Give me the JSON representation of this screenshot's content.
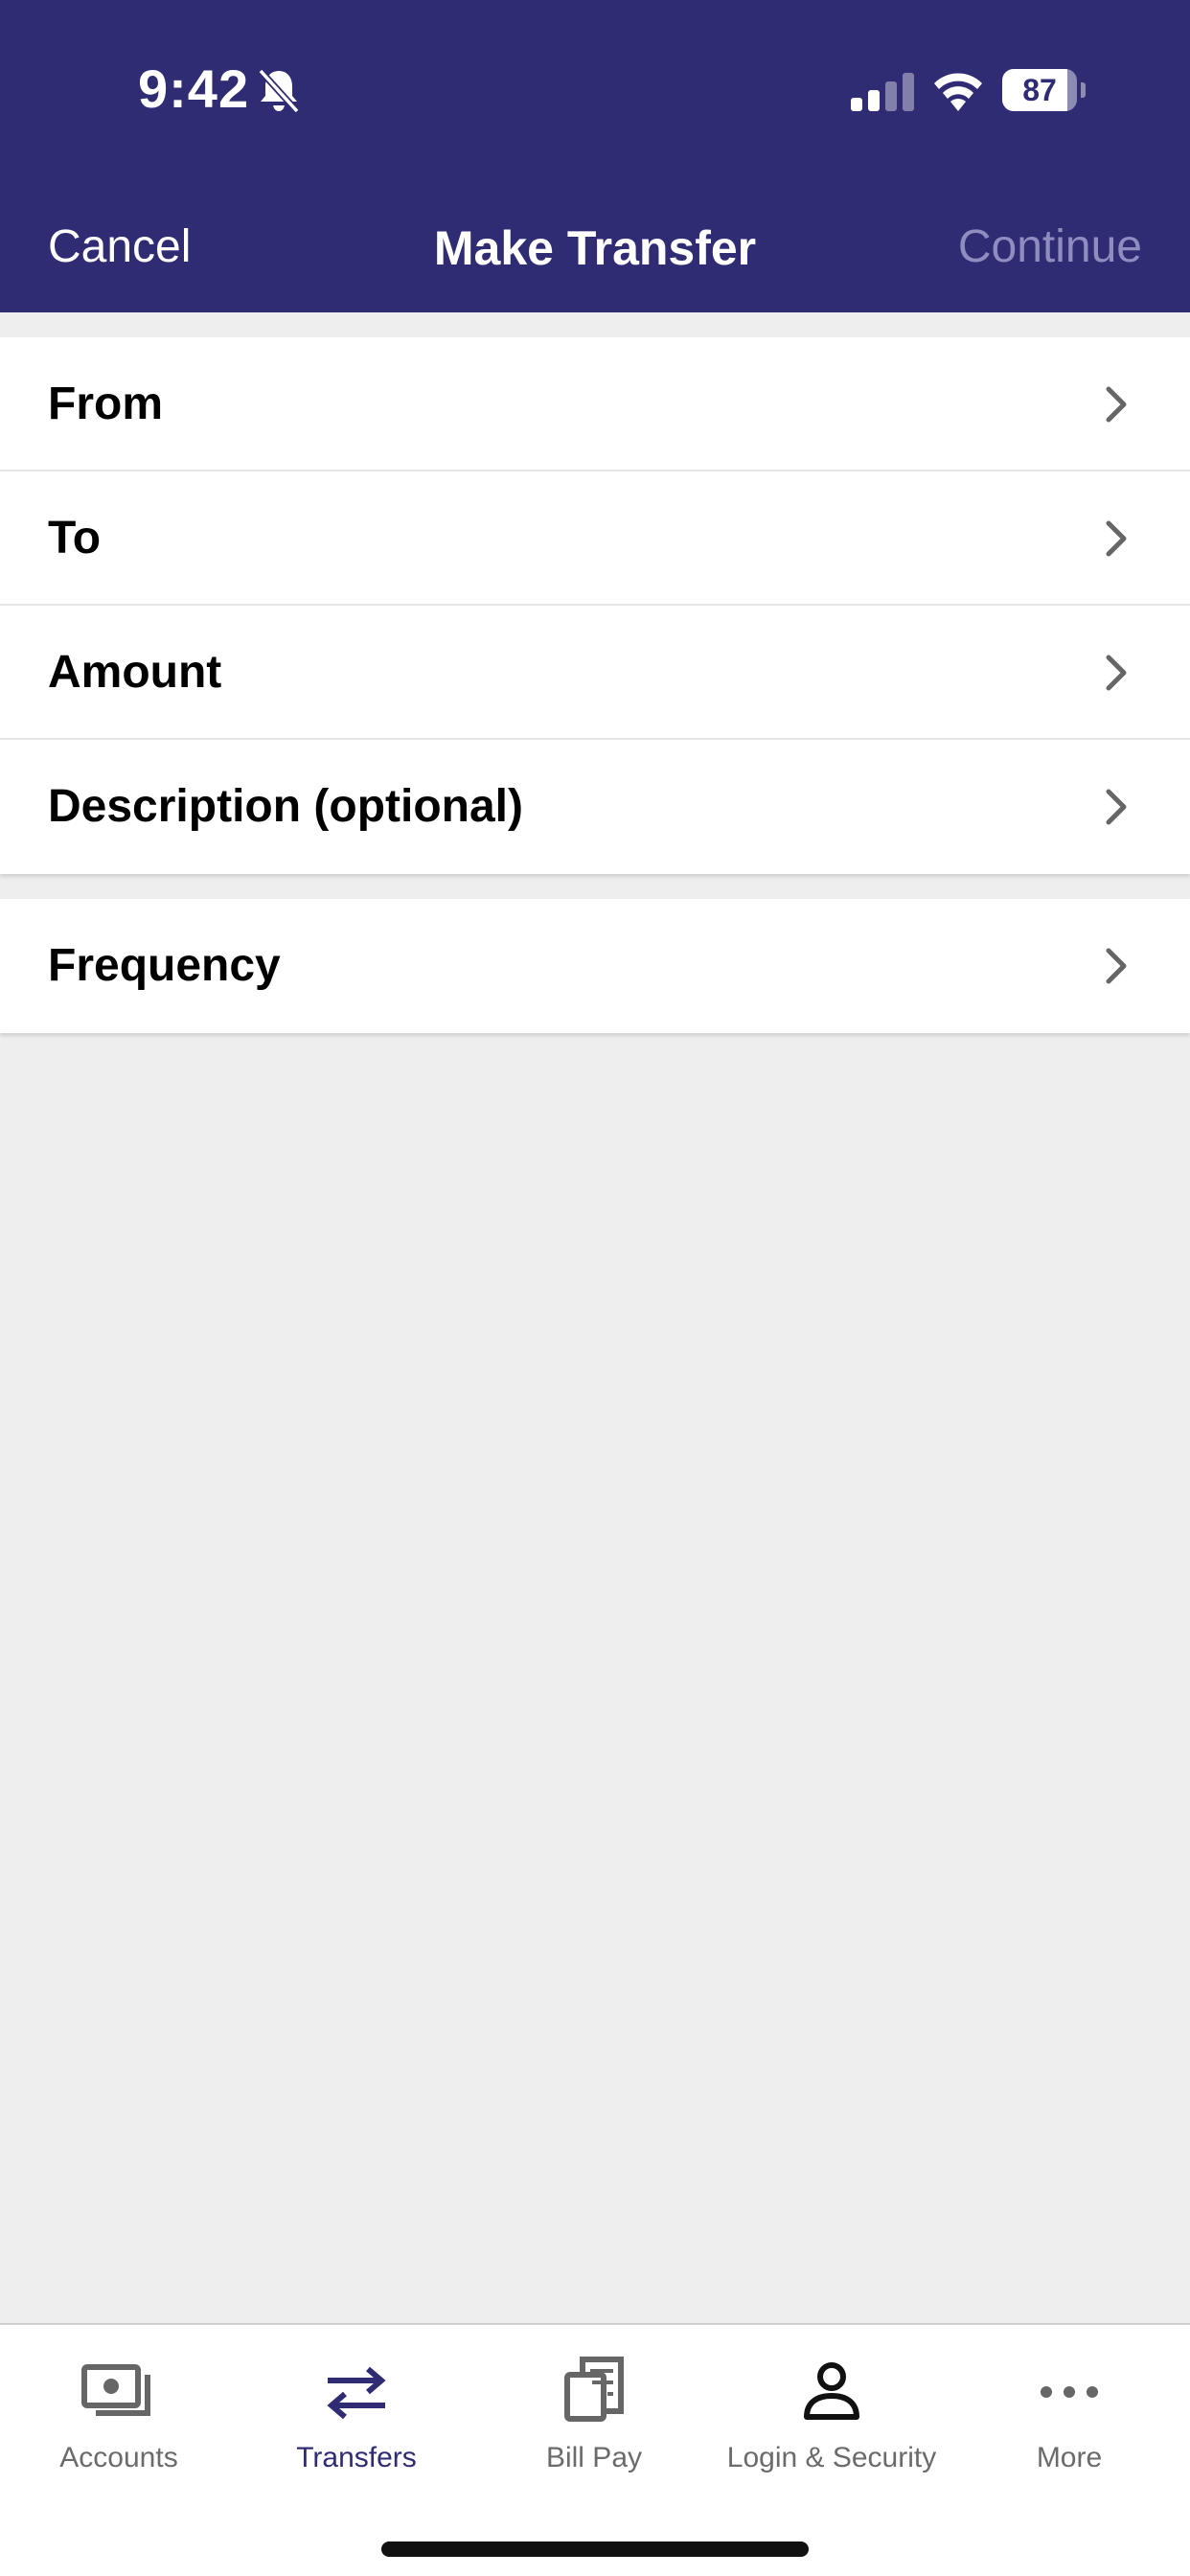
{
  "status_bar": {
    "time": "9:42",
    "battery": "87",
    "battery_level": 0.87
  },
  "nav": {
    "cancel_label": "Cancel",
    "title": "Make Transfer",
    "continue_label": "Continue"
  },
  "form": {
    "rows": [
      {
        "label": "From"
      },
      {
        "label": "To"
      },
      {
        "label": "Amount"
      },
      {
        "label": "Description (optional)"
      }
    ],
    "frequency_label": "Frequency"
  },
  "tab_bar": {
    "items": [
      {
        "label": "Accounts",
        "icon": "cash-icon"
      },
      {
        "label": "Transfers",
        "icon": "transfer-arrows-icon"
      },
      {
        "label": "Bill Pay",
        "icon": "receipt-icon"
      },
      {
        "label": "Login & Security",
        "icon": "person-icon"
      },
      {
        "label": "More",
        "icon": "more-dots-icon"
      }
    ],
    "active_index": 1
  },
  "colors": {
    "header_bg": "#2f2c74",
    "page_bg": "#eeeeee",
    "continue_disabled": "#8f8cbf",
    "tab_active": "#2f2c74",
    "tab_inactive": "#6b6b6b"
  }
}
